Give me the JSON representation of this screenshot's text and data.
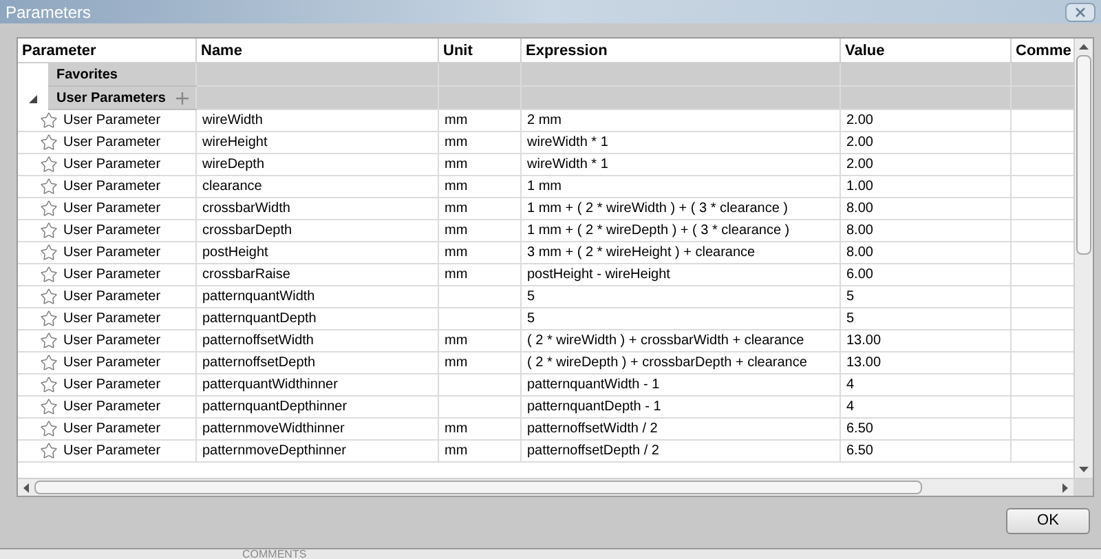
{
  "window": {
    "title": "Parameters"
  },
  "table": {
    "columns": [
      "Parameter",
      "Name",
      "Unit",
      "Expression",
      "Value",
      "Comme"
    ],
    "groups": [
      {
        "label": "Favorites",
        "expanded": false
      },
      {
        "label": "User Parameters",
        "expanded": true
      }
    ],
    "rows": [
      {
        "type": "User Parameter",
        "name": "wireWidth",
        "unit": "mm",
        "expression": "2 mm",
        "value": "2.00"
      },
      {
        "type": "User Parameter",
        "name": "wireHeight",
        "unit": "mm",
        "expression": "wireWidth * 1",
        "value": "2.00"
      },
      {
        "type": "User Parameter",
        "name": "wireDepth",
        "unit": "mm",
        "expression": "wireWidth * 1",
        "value": "2.00"
      },
      {
        "type": "User Parameter",
        "name": "clearance",
        "unit": "mm",
        "expression": "1 mm",
        "value": "1.00"
      },
      {
        "type": "User Parameter",
        "name": "crossbarWidth",
        "unit": "mm",
        "expression": "1 mm + ( 2 * wireWidth ) + ( 3 * clearance )",
        "value": "8.00"
      },
      {
        "type": "User Parameter",
        "name": "crossbarDepth",
        "unit": "mm",
        "expression": "1 mm + ( 2 * wireDepth ) + ( 3 * clearance )",
        "value": "8.00"
      },
      {
        "type": "User Parameter",
        "name": "postHeight",
        "unit": "mm",
        "expression": "3 mm + ( 2 * wireHeight ) + clearance",
        "value": "8.00"
      },
      {
        "type": "User Parameter",
        "name": "crossbarRaise",
        "unit": "mm",
        "expression": "postHeight - wireHeight",
        "value": "6.00"
      },
      {
        "type": "User Parameter",
        "name": "patternquantWidth",
        "unit": "",
        "expression": "5",
        "value": "5"
      },
      {
        "type": "User Parameter",
        "name": "patternquantDepth",
        "unit": "",
        "expression": "5",
        "value": "5"
      },
      {
        "type": "User Parameter",
        "name": "patternoffsetWidth",
        "unit": "mm",
        "expression": "( 2 * wireWidth ) + crossbarWidth + clearance",
        "value": "13.00"
      },
      {
        "type": "User Parameter",
        "name": "patternoffsetDepth",
        "unit": "mm",
        "expression": "( 2 * wireDepth ) + crossbarDepth + clearance",
        "value": "13.00"
      },
      {
        "type": "User Parameter",
        "name": "patterquantWidthinner",
        "unit": "",
        "expression": "patternquantWidth - 1",
        "value": "4"
      },
      {
        "type": "User Parameter",
        "name": "patternquantDepthinner",
        "unit": "",
        "expression": "patternquantDepth - 1",
        "value": "4"
      },
      {
        "type": "User Parameter",
        "name": "patternmoveWidthinner",
        "unit": "mm",
        "expression": "patternoffsetWidth / 2",
        "value": "6.50"
      },
      {
        "type": "User Parameter",
        "name": "patternmoveDepthinner",
        "unit": "mm",
        "expression": "patternoffsetDepth / 2",
        "value": "6.50"
      }
    ]
  },
  "buttons": [
    "OK"
  ],
  "background": {
    "label": "COMMENTS"
  }
}
